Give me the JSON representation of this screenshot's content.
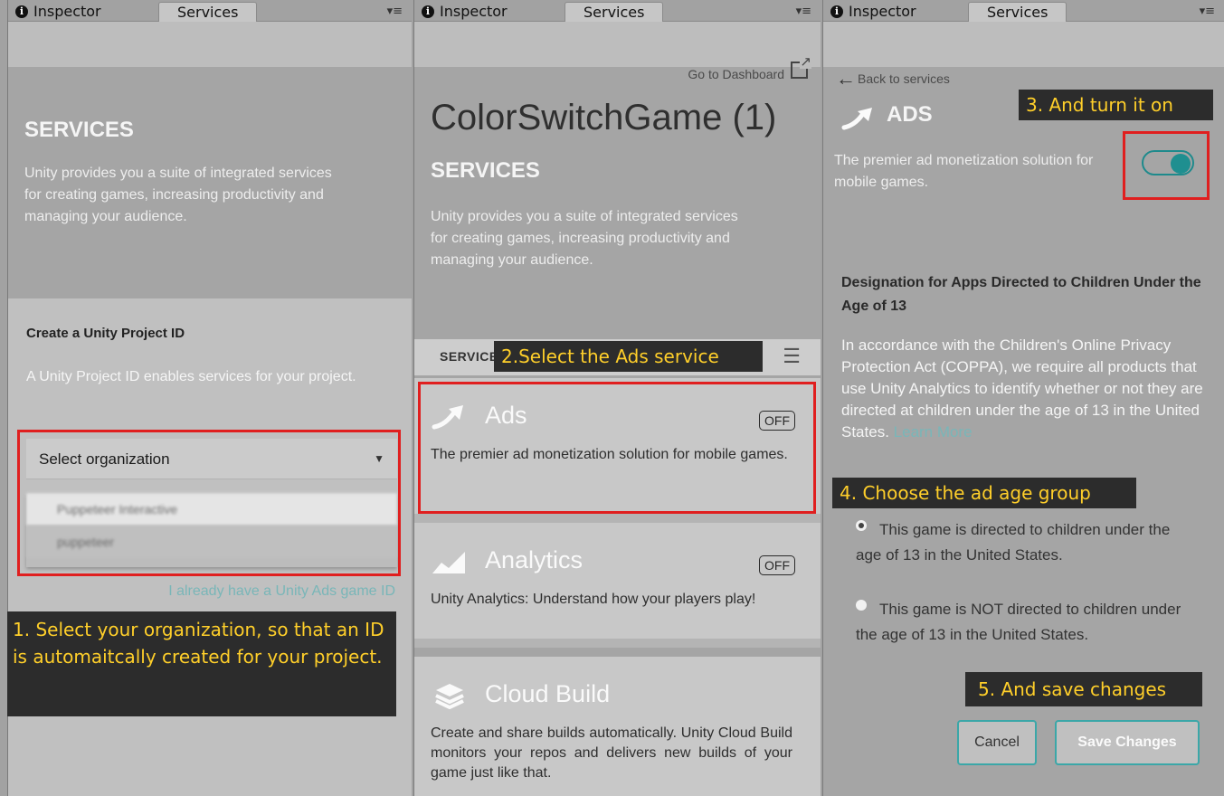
{
  "tabs": {
    "inspector": "Inspector",
    "services": "Services"
  },
  "services_header": {
    "title": "SERVICES",
    "description": "Unity provides you a suite of integrated services for creating games, increasing productivity and managing your audience."
  },
  "panel1": {
    "create_title": "Create a Unity Project ID",
    "create_description": "A Unity Project ID enables services for your project.",
    "select_label": "Select organization",
    "options": [
      "Puppeteer Interactive",
      "puppeteer"
    ],
    "already_have_id": "I already have a Unity Ads game ID",
    "callout": "1. Select your organization, so that an ID is automaitcally created for your project."
  },
  "panel2": {
    "go_to_dashboard": "Go to Dashboard",
    "project_title": "ColorSwitchGame (1)",
    "list_label": "SERVICE",
    "callout": "2.Select the Ads service",
    "cards": [
      {
        "name": "Ads",
        "description": "The premier ad monetization solution for mobile games.",
        "status": "OFF"
      },
      {
        "name": "Analytics",
        "description": "Unity Analytics: Understand how your players play!",
        "status": "OFF"
      },
      {
        "name": "Cloud Build",
        "description": "Create and share builds automatically. Unity Cloud Build monitors your repos and delivers new builds of your game just like that."
      }
    ]
  },
  "panel3": {
    "back": "Back to services",
    "ads_title": "ADS",
    "ads_description": "The premier ad monetization solution for mobile games.",
    "callout_turn_on": "3. And turn it on",
    "coppa_title": "Designation for Apps Directed to Children Under the Age of 13",
    "coppa_text": "In accordance with the Children's Online Privacy Protection Act (COPPA), we require all products that use Unity Analytics to identify whether or not they are directed at children under the age of 13 in the United States.",
    "learn_more": "Learn More",
    "callout_age": "4. Choose the ad age group",
    "radio_directed": "This game is directed to children under the age of 13 in the United States.",
    "radio_not_directed": "This game is NOT directed to children under the age of 13 in the United States.",
    "callout_save": "5. And save changes",
    "cancel": "Cancel",
    "save": "Save Changes"
  },
  "colors": {
    "callout_bg": "#2c2c2c",
    "callout_text": "#ffcf2a",
    "highlight": "#e01f1f",
    "accent": "#1f8f90"
  }
}
